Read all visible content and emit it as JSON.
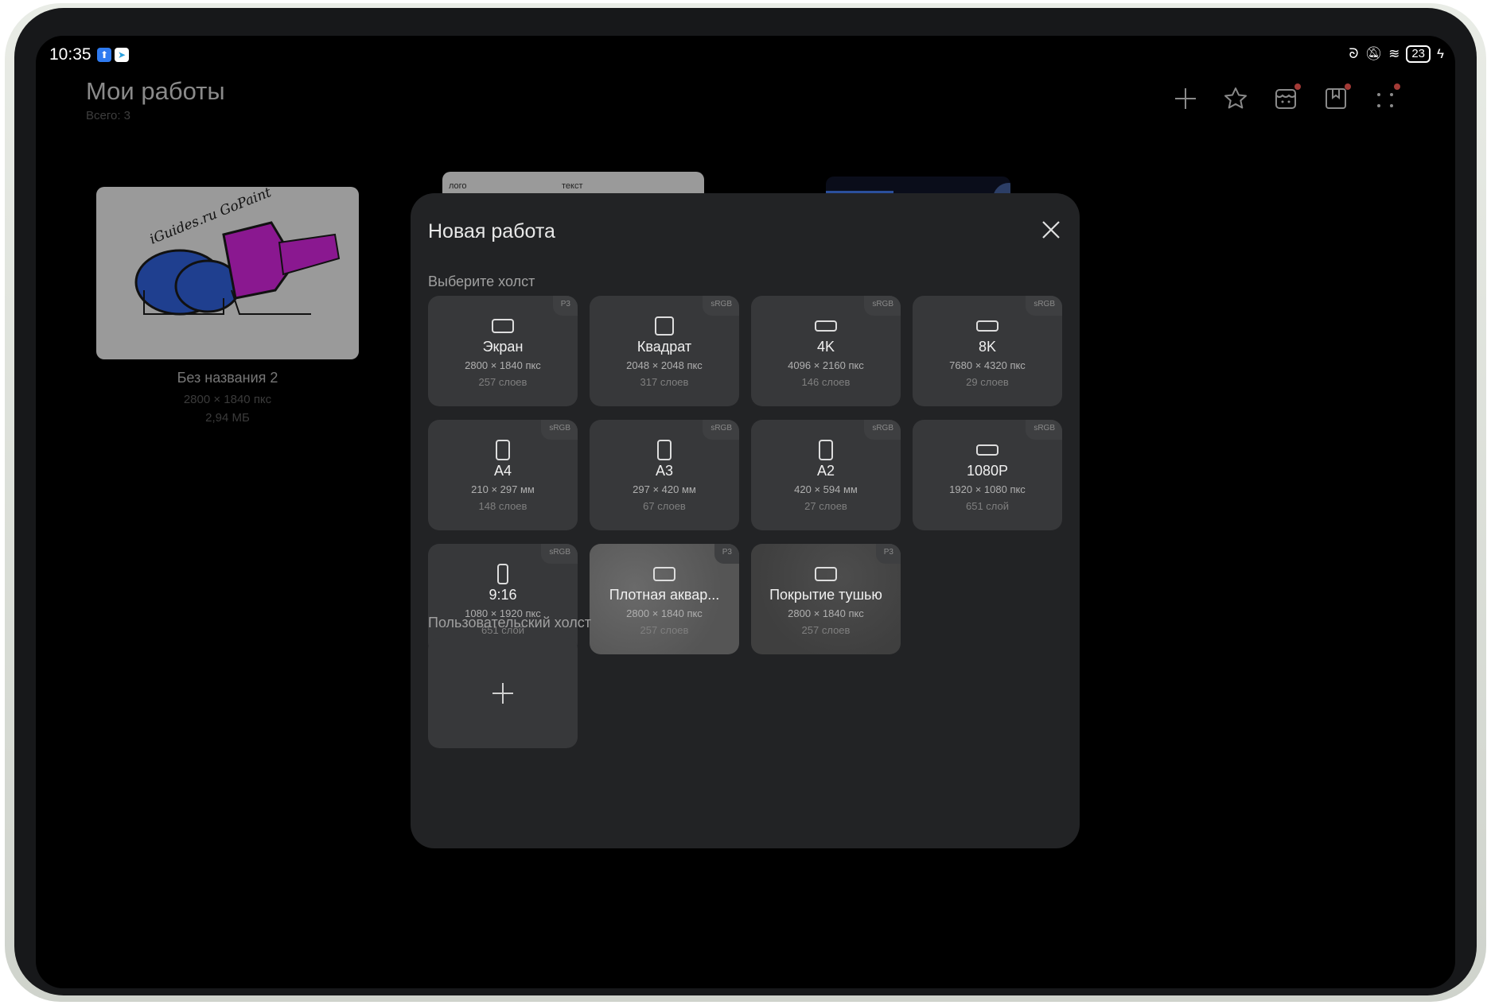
{
  "status_bar": {
    "time": "10:35",
    "battery": "23"
  },
  "header": {
    "title": "Мои работы",
    "subtitle": "Всего: 3"
  },
  "toolbar": {
    "icons": [
      "plus-icon",
      "star-icon",
      "store-icon",
      "bookmark-icon",
      "apps-icon"
    ]
  },
  "works": [
    {
      "name": "Без названия 2",
      "size": "2800 × 1840 пкс",
      "file_size": "2,94 МБ",
      "art_text": "iGuides.ru GoPaint"
    },
    {
      "labels": [
        "лого",
        "текст"
      ]
    }
  ],
  "dialog": {
    "title": "Новая работа",
    "section_presets": "Выберите холст",
    "section_custom": "Пользовательский холст",
    "presets": [
      {
        "name": "Экран",
        "dims": "2800 × 1840 пкс",
        "layers": "257 слоев",
        "badge": "P3",
        "orientation": "landscape"
      },
      {
        "name": "Квадрат",
        "dims": "2048 × 2048 пкс",
        "layers": "317 слоев",
        "badge": "sRGB",
        "orientation": "square"
      },
      {
        "name": "4K",
        "dims": "4096 × 2160 пкс",
        "layers": "146 слоев",
        "badge": "sRGB",
        "orientation": "wide"
      },
      {
        "name": "8K",
        "dims": "7680 × 4320 пкс",
        "layers": "29 слоев",
        "badge": "sRGB",
        "orientation": "wide"
      },
      {
        "name": "A4",
        "dims": "210 × 297 мм",
        "layers": "148 слоев",
        "badge": "sRGB",
        "orientation": "portrait"
      },
      {
        "name": "A3",
        "dims": "297 × 420 мм",
        "layers": "67 слоев",
        "badge": "sRGB",
        "orientation": "portrait"
      },
      {
        "name": "A2",
        "dims": "420 × 594 мм",
        "layers": "27 слоев",
        "badge": "sRGB",
        "orientation": "portrait"
      },
      {
        "name": "1080P",
        "dims": "1920 × 1080 пкс",
        "layers": "651 слой",
        "badge": "sRGB",
        "orientation": "wide"
      },
      {
        "name": "9:16",
        "dims": "1080 × 1920 пкс",
        "layers": "651 слой",
        "badge": "sRGB",
        "orientation": "tall"
      },
      {
        "name": "Плотная аквар...",
        "dims": "2800 × 1840 пкс",
        "layers": "257 слоев",
        "badge": "P3",
        "orientation": "landscape"
      },
      {
        "name": "Покрытие тушью",
        "dims": "2800 × 1840 пкс",
        "layers": "257 слоев",
        "badge": "P3",
        "orientation": "landscape"
      }
    ]
  }
}
